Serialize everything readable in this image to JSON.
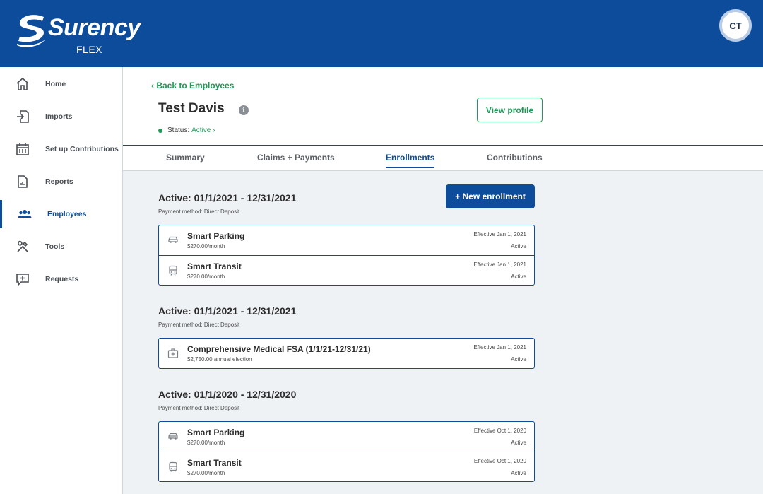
{
  "header": {
    "brand": "Surency",
    "brand_sub": "FLEX",
    "avatar_initials": "CT",
    "color": "#0d4c9a"
  },
  "sidebar": {
    "items": [
      {
        "label": "Home",
        "icon": "home-icon"
      },
      {
        "label": "Imports",
        "icon": "import-icon"
      },
      {
        "label": "Set up Contributions",
        "icon": "calendar-icon"
      },
      {
        "label": "Reports",
        "icon": "report-icon"
      },
      {
        "label": "Employees",
        "icon": "users-icon",
        "active": true
      },
      {
        "label": "Tools",
        "icon": "tools-icon"
      },
      {
        "label": "Requests",
        "icon": "request-icon"
      }
    ]
  },
  "employee": {
    "back_label": "Back to Employees",
    "name": "Test Davis",
    "status_label": "Status:",
    "status_value": "Active",
    "view_profile_label": "View profile"
  },
  "tabs": [
    {
      "label": "Summary"
    },
    {
      "label": "Claims + Payments"
    },
    {
      "label": "Enrollments",
      "active": true
    },
    {
      "label": "Contributions"
    }
  ],
  "enrollments": {
    "new_button_label": "+ New enrollment",
    "sections": [
      {
        "title": "Active: 01/1/2021 - 12/31/2021",
        "payment": "Payment method: Direct Deposit",
        "items": [
          {
            "name": "Smart Parking",
            "amount": "$270.00/month",
            "effective": "Effective Jan 1, 2021",
            "status": "Active",
            "icon": "car-icon"
          },
          {
            "name": "Smart Transit",
            "amount": "$270.00/month",
            "effective": "Effective Jan 1, 2021",
            "status": "Active",
            "icon": "bus-icon"
          }
        ]
      },
      {
        "title": "Active: 01/1/2021 - 12/31/2021",
        "payment": "Payment method: Direct Deposit",
        "items": [
          {
            "name": "Comprehensive Medical FSA (1/1/21-12/31/21)",
            "amount": "$2,750.00 annual election",
            "effective": "Effective Jan 1, 2021",
            "status": "Active",
            "icon": "medical-kit-icon"
          }
        ]
      },
      {
        "title": "Active: 01/1/2020 - 12/31/2020",
        "payment": "Payment method: Direct Deposit",
        "items": [
          {
            "name": "Smart Parking",
            "amount": "$270.00/month",
            "effective": "Effective Oct 1, 2020",
            "status": "Active",
            "icon": "car-icon"
          },
          {
            "name": "Smart Transit",
            "amount": "$270.00/month",
            "effective": "Effective Oct 1, 2020",
            "status": "Active",
            "icon": "bus-icon"
          }
        ]
      }
    ]
  }
}
